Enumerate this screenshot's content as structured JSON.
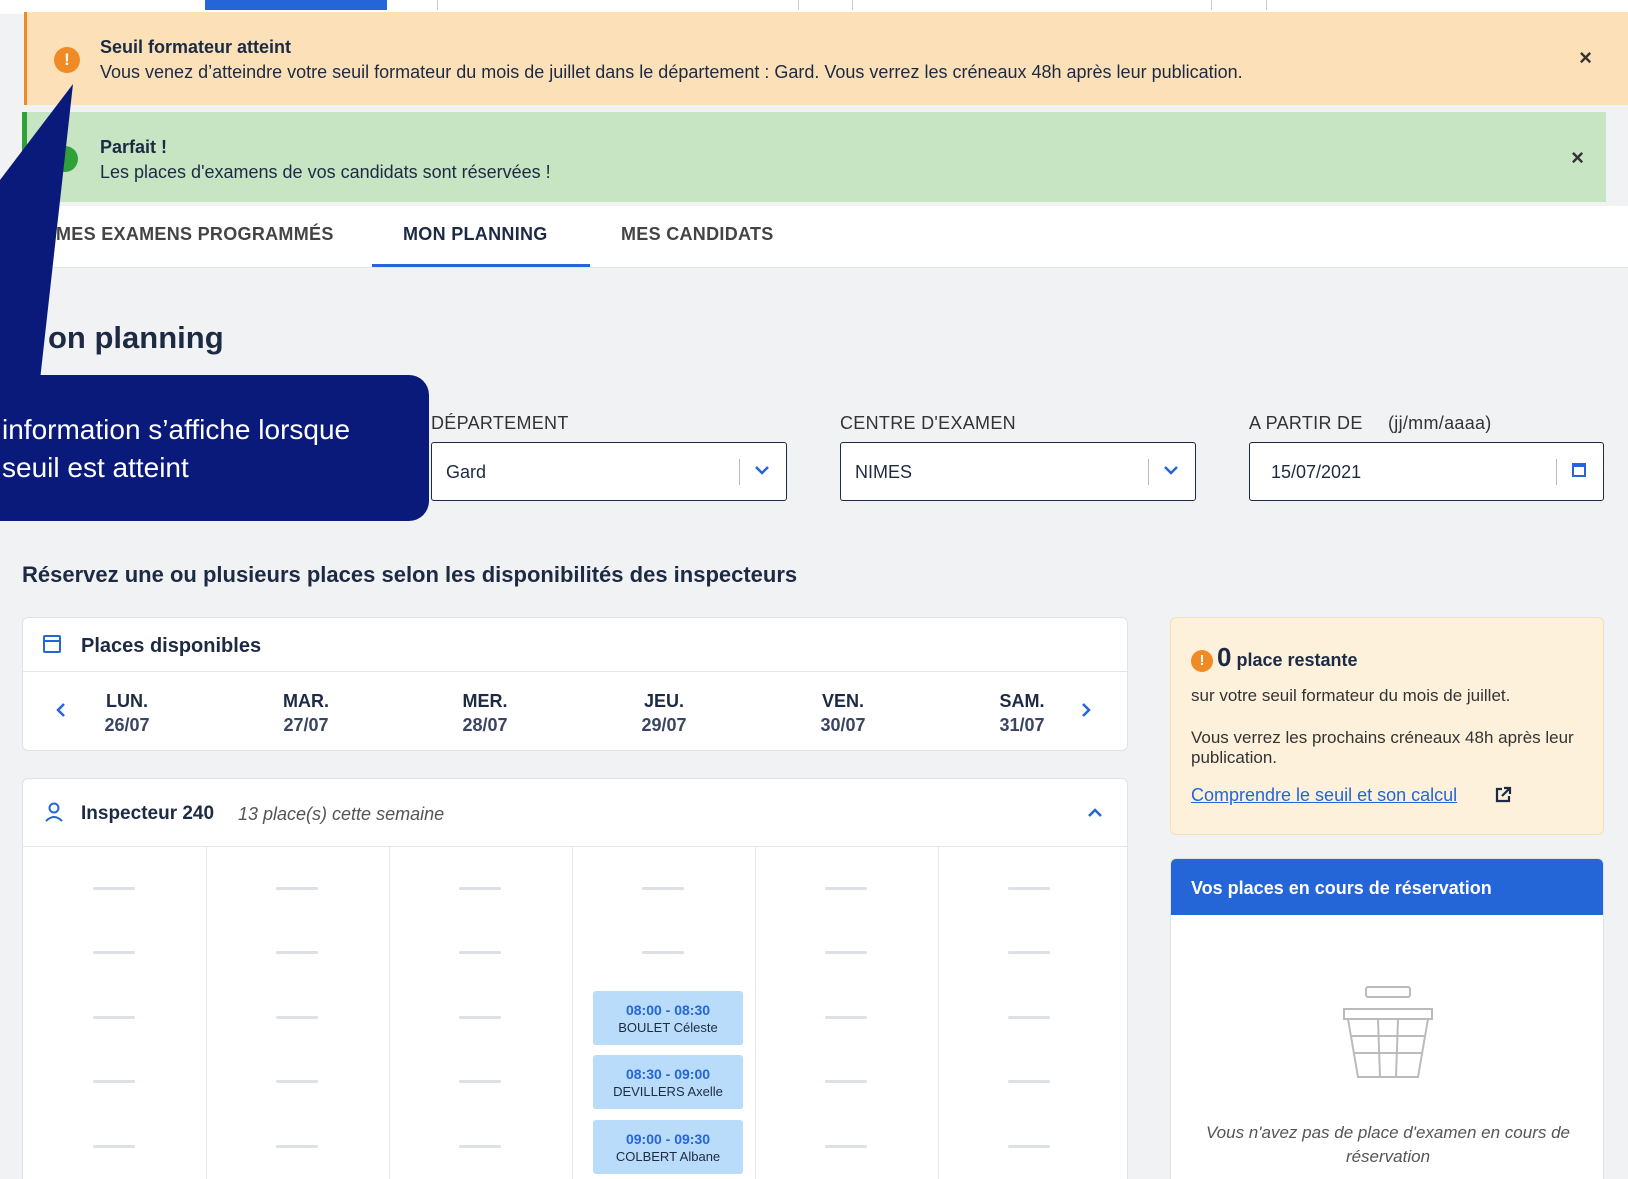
{
  "alerts": {
    "warning": {
      "title": "Seuil formateur atteint",
      "message": "Vous venez d’atteindre votre seuil formateur du mois de juillet dans le département : Gard. Vous verrez les créneaux 48h après leur publication.",
      "close": "×",
      "icon": "!"
    },
    "success": {
      "title": "Parfait !",
      "message": "Les places d'examens de vos candidats sont réservées !",
      "close": "×"
    }
  },
  "tabs": [
    {
      "label": "MES EXAMENS PROGRAMMÉS"
    },
    {
      "label": "MON PLANNING"
    },
    {
      "label": "MES CANDIDATS"
    }
  ],
  "page": {
    "title": "on planning"
  },
  "callout": {
    "line1": "information s’affiche lorsque",
    "line2": " seuil est atteint"
  },
  "filters": {
    "departement": {
      "label": "DÉPARTEMENT",
      "value": "Gard"
    },
    "centre": {
      "label": "CENTRE D'EXAMEN",
      "value": "NIMES"
    },
    "date": {
      "label": "A PARTIR DE",
      "hint": "(jj/mm/aaaa)",
      "value": "15/07/2021"
    }
  },
  "section_title": "Réservez une ou plusieurs places selon les disponibilités des inspecteurs",
  "places": {
    "title": "Places disponibles",
    "days": [
      {
        "name": "LUN.",
        "date": "26/07"
      },
      {
        "name": "MAR.",
        "date": "27/07"
      },
      {
        "name": "MER.",
        "date": "28/07"
      },
      {
        "name": "JEU.",
        "date": "29/07"
      },
      {
        "name": "VEN.",
        "date": "30/07"
      },
      {
        "name": "SAM.",
        "date": "31/07"
      }
    ]
  },
  "inspector": {
    "name": "Inspecteur 240",
    "count": "13 place(s) cette semaine",
    "slots": [
      {
        "time": "08:00 - 08:30",
        "candidate": "BOULET Céleste"
      },
      {
        "time": "08:30 - 09:00",
        "candidate": "DEVILLERS Axelle"
      },
      {
        "time": "09:00 - 09:30",
        "candidate": "COLBERT Albane"
      }
    ]
  },
  "seuil": {
    "icon": "!",
    "count": "0",
    "label": " place restante",
    "line1": "sur votre seuil formateur du mois de juillet.",
    "line2": "Vous verrez les prochains créneaux 48h après leur publication.",
    "link": "Comprendre le seuil et son calcul"
  },
  "reservation": {
    "title": "Vos places en cours de réservation",
    "empty": "Vous n'avez pas de place d'examen en cours de réservation"
  },
  "colors": {
    "accent": "#2465d8",
    "warning": "#f08a24",
    "success": "#30a038",
    "callout": "#0a1a7a"
  }
}
